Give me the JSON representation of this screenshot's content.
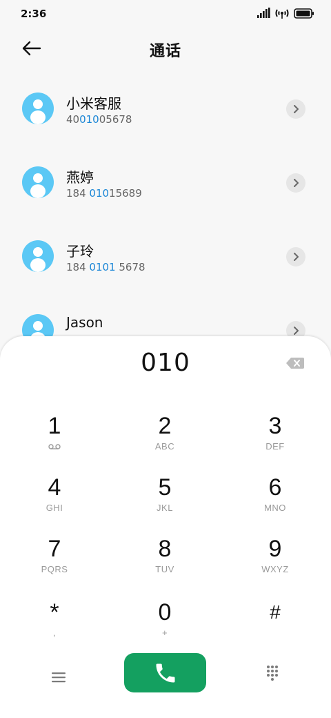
{
  "status_bar": {
    "time": "2:36",
    "icons": [
      "signal-icon",
      "wifi-calling-icon",
      "battery-icon"
    ]
  },
  "header": {
    "title": "通话",
    "back_icon": "back-arrow-icon"
  },
  "contacts": [
    {
      "name": "小米客服",
      "number_pre": "40",
      "number_hl": "010",
      "number_post": "05678"
    },
    {
      "name": "燕婷",
      "number_pre": "184 ",
      "number_hl": "010",
      "number_post": "15689"
    },
    {
      "name": "子玲",
      "number_pre": "184 ",
      "number_hl": "0101",
      "number_post": " 5678"
    },
    {
      "name": "Jason",
      "number_pre": "",
      "number_hl": "",
      "number_post": ""
    }
  ],
  "dialer": {
    "input_value": "010",
    "keys": [
      {
        "digit": "1",
        "letters": ""
      },
      {
        "digit": "2",
        "letters": "ABC"
      },
      {
        "digit": "3",
        "letters": "DEF"
      },
      {
        "digit": "4",
        "letters": "GHI"
      },
      {
        "digit": "5",
        "letters": "JKL"
      },
      {
        "digit": "6",
        "letters": "MNO"
      },
      {
        "digit": "7",
        "letters": "PQRS"
      },
      {
        "digit": "8",
        "letters": "TUV"
      },
      {
        "digit": "9",
        "letters": "WXYZ"
      },
      {
        "digit": "*",
        "letters": ","
      },
      {
        "digit": "0",
        "letters": "+"
      },
      {
        "digit": "#",
        "letters": ""
      }
    ]
  },
  "colors": {
    "accent_blue": "#1b86d6",
    "avatar": "#5bc8f5",
    "call_green": "#14a060"
  }
}
